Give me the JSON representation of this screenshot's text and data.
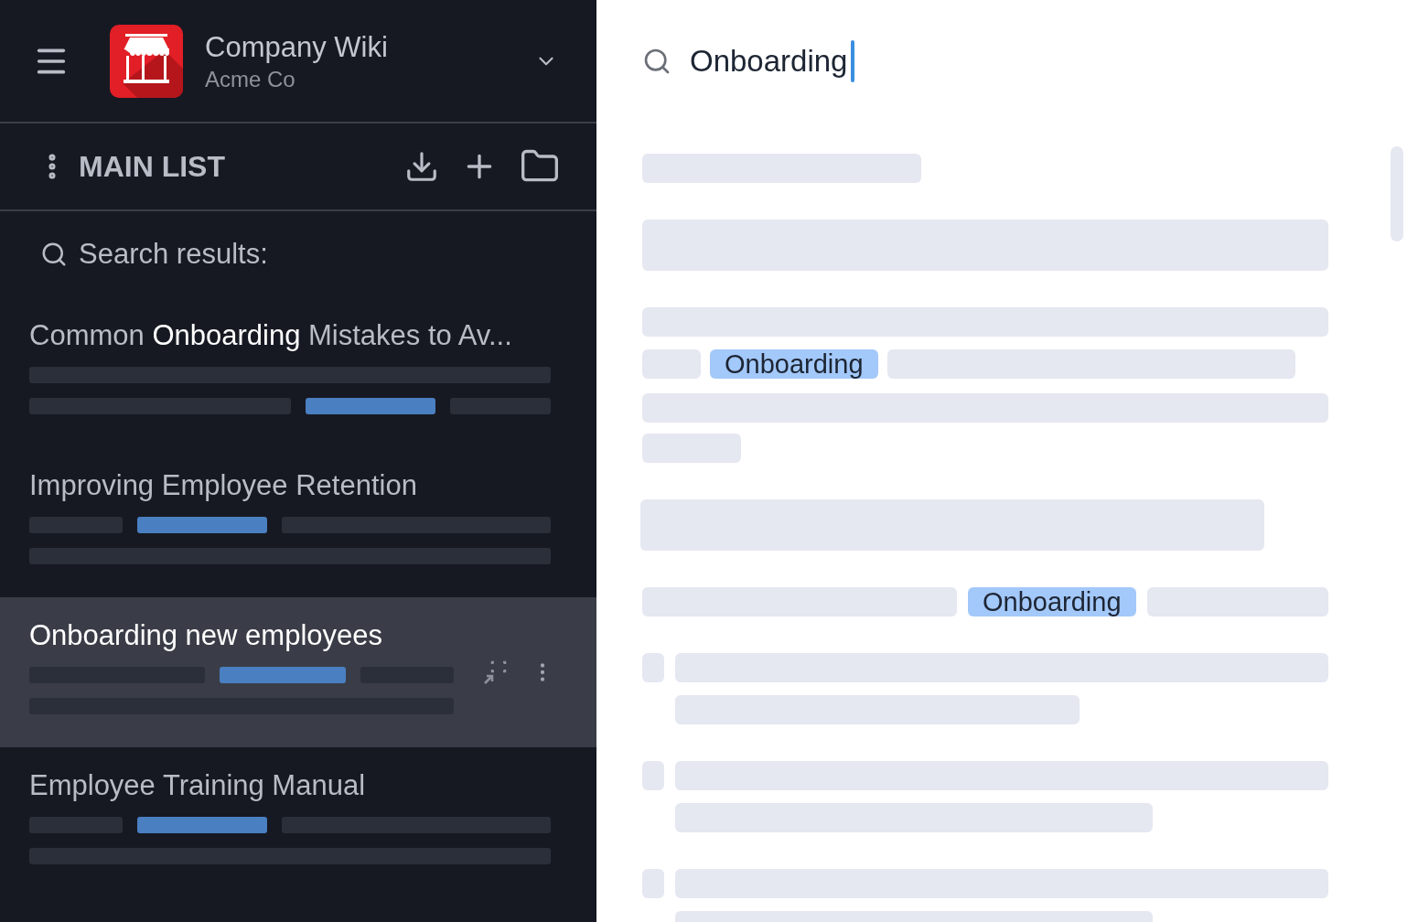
{
  "header": {
    "title": "Company Wiki",
    "subtitle": "Acme Co"
  },
  "toolbar": {
    "title": "MAIN LIST"
  },
  "results_label": "Search results:",
  "results": [
    {
      "title": "Common **Onboarding** Mistakes to Av...",
      "selected": false
    },
    {
      "title": "Improving Employee Retention",
      "selected": false
    },
    {
      "title": "Onboarding new employees",
      "selected": true
    },
    {
      "title": "Employee Training Manual",
      "selected": false
    }
  ],
  "search": {
    "value": "Onboarding"
  },
  "document": {
    "highlights": [
      "Onboarding",
      "Onboarding"
    ]
  }
}
